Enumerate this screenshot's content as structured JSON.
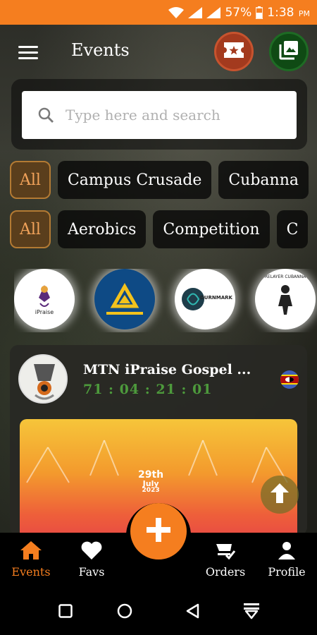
{
  "status_bar": {
    "battery": "57%",
    "time": "1:38",
    "ampm": "PM"
  },
  "header": {
    "title": "Events"
  },
  "search": {
    "placeholder": "Type here and search"
  },
  "category_filters": [
    "All",
    "Campus Crusade",
    "Cubanna"
  ],
  "type_filters": [
    "All",
    "Aerobics",
    "Competition",
    "C"
  ],
  "organizers": [
    {
      "label": "iPraise"
    },
    {
      "label": ""
    },
    {
      "label": "DURNMARK"
    },
    {
      "label": "RELAYER CUBANNA"
    }
  ],
  "event_card": {
    "title": "MTN iPraise Gospel ...",
    "countdown": "71 : 04 : 21 : 01",
    "banner": {
      "day": "29th",
      "month": "July",
      "year": "2023"
    }
  },
  "bottom_nav": [
    {
      "label": "Events",
      "icon": "home-icon",
      "active": true
    },
    {
      "label": "Favs",
      "icon": "heart-icon",
      "active": false
    },
    {
      "label": "Orders",
      "icon": "cart-check-icon",
      "active": false
    },
    {
      "label": "Profile",
      "icon": "person-icon",
      "active": false
    }
  ],
  "colors": {
    "accent": "#f57e1f",
    "countdown": "#4d9a3c",
    "ticket": "#a33a1e",
    "gallery": "#0f4a14"
  }
}
